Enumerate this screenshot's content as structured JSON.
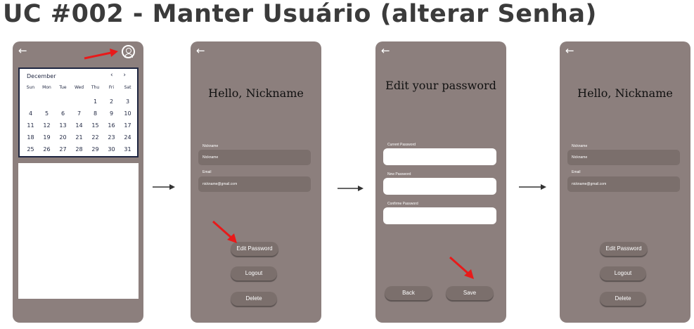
{
  "title": "UC #002 - Manter Usuário (alterar Senha)",
  "back_glyph": "←",
  "colors": {
    "phone_bg": "#8c7f7d",
    "field_bg": "#7b6f6c",
    "highlight_arrow": "#e81a1a"
  },
  "screen1": {
    "calendar": {
      "month": "December",
      "nav": "‹ ›",
      "weekdays": [
        "Sun",
        "Mon",
        "Tue",
        "Wed",
        "Thu",
        "Fri",
        "Sat"
      ],
      "days": [
        "",
        "",
        "",
        "",
        "1",
        "2",
        "3",
        "4",
        "5",
        "6",
        "7",
        "8",
        "9",
        "10",
        "11",
        "12",
        "13",
        "14",
        "15",
        "16",
        "17",
        "18",
        "19",
        "20",
        "21",
        "22",
        "23",
        "24",
        "25",
        "26",
        "27",
        "28",
        "29",
        "30",
        "31"
      ]
    }
  },
  "screen2": {
    "greeting": "Hello, Nickname",
    "nickname_label": "Nickname",
    "nickname_value": "Nickname",
    "email_label": "Email",
    "email_value": "nickname@gmail.com",
    "edit_password": "Edit Password",
    "logout": "Logout",
    "delete": "Delete"
  },
  "screen3": {
    "heading": "Edit your password",
    "current_label": "Current Password",
    "new_label": "New Password",
    "confirm_label": "Confirme Password",
    "back": "Back",
    "save": "Save"
  },
  "screen4": {
    "greeting": "Hello, Nickname",
    "nickname_label": "Nickname",
    "nickname_value": "Nickname",
    "email_label": "Email",
    "email_value": "nickname@gmail.com",
    "edit_password": "Edit Password",
    "logout": "Logout",
    "delete": "Delete"
  }
}
